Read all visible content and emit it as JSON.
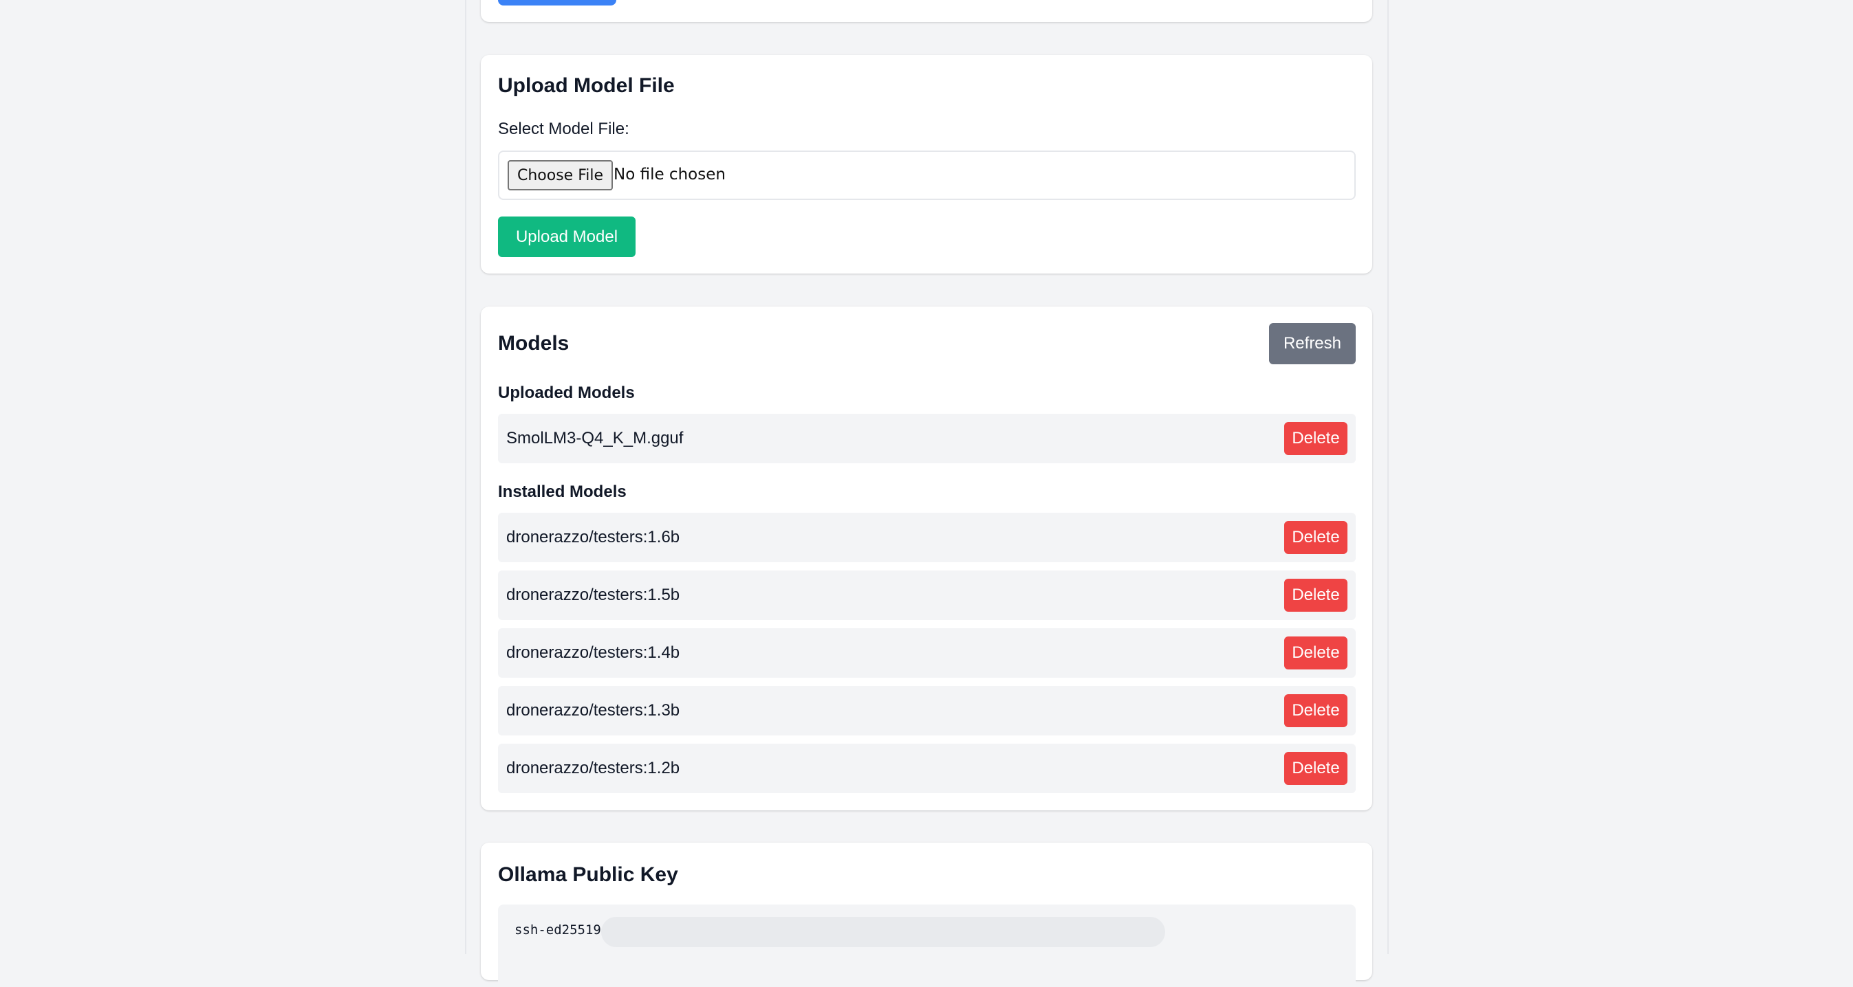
{
  "upload": {
    "title": "Upload Model File",
    "select_label": "Select Model File:",
    "choose_file_label": "Choose File",
    "no_file_text": "No file chosen",
    "upload_button": "Upload Model"
  },
  "models": {
    "title": "Models",
    "refresh_button": "Refresh",
    "uploaded_heading": "Uploaded Models",
    "uploaded": [
      {
        "name": "SmolLM3-Q4_K_M.gguf",
        "delete_label": "Delete"
      }
    ],
    "installed_heading": "Installed Models",
    "installed": [
      {
        "name": "dronerazzo/testers:1.6b",
        "delete_label": "Delete"
      },
      {
        "name": "dronerazzo/testers:1.5b",
        "delete_label": "Delete"
      },
      {
        "name": "dronerazzo/testers:1.4b",
        "delete_label": "Delete"
      },
      {
        "name": "dronerazzo/testers:1.3b",
        "delete_label": "Delete"
      },
      {
        "name": "dronerazzo/testers:1.2b",
        "delete_label": "Delete"
      }
    ]
  },
  "public_key": {
    "title": "Ollama Public Key",
    "key_prefix": "ssh-ed25519"
  },
  "colors": {
    "background": "#f3f4f6",
    "primary_blue": "#3b82f6",
    "upload_green": "#10b981",
    "refresh_gray": "#6b7280",
    "delete_red": "#ef4444"
  }
}
